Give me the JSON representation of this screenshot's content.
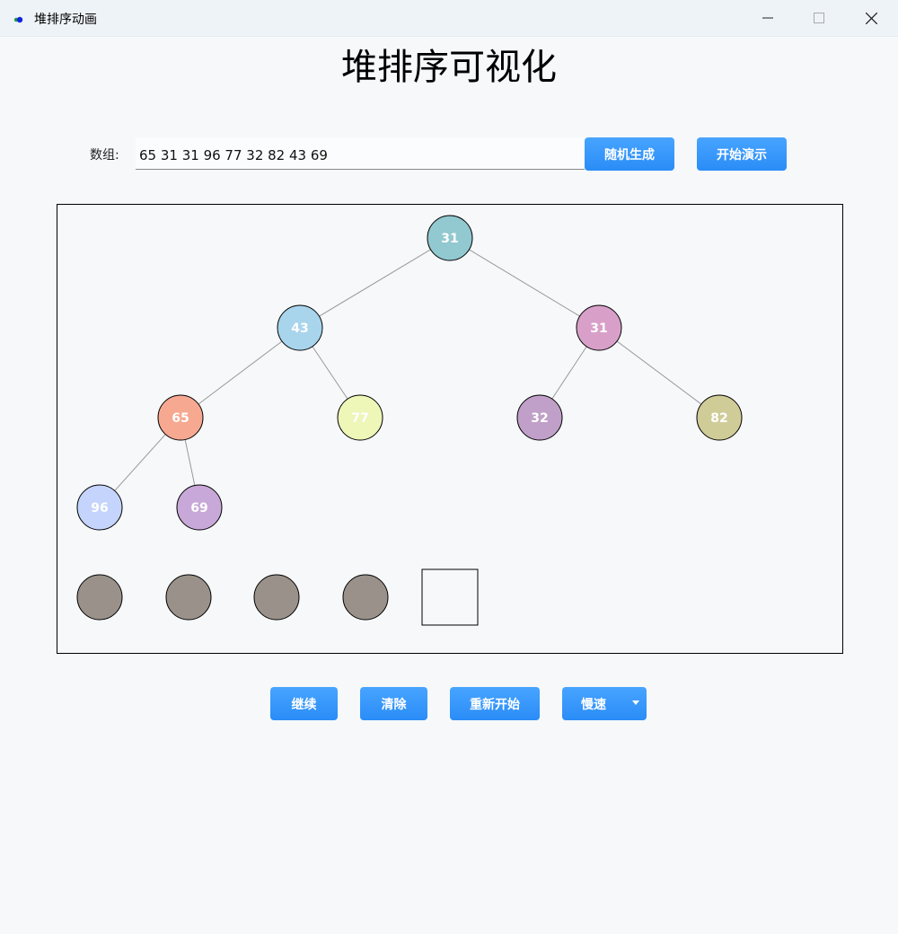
{
  "window": {
    "title": "堆排序动画"
  },
  "page": {
    "title": "堆排序可视化"
  },
  "input": {
    "label": "数组:",
    "value": "65 31 31 96 77 32 82 43 69"
  },
  "buttons": {
    "random": "随机生成",
    "start": "开始演示",
    "continue": "继续",
    "clear": "清除",
    "restart": "重新开始",
    "speed": "慢速"
  },
  "tree": {
    "nodes": [
      {
        "value": "31",
        "color": "#92c8d0"
      },
      {
        "value": "43",
        "color": "#a8d4ec"
      },
      {
        "value": "31",
        "color": "#d8a0c8"
      },
      {
        "value": "65",
        "color": "#f6a890"
      },
      {
        "value": "77",
        "color": "#eef6b8"
      },
      {
        "value": "32",
        "color": "#c0a0c8"
      },
      {
        "value": "82",
        "color": "#d0cc98"
      },
      {
        "value": "96",
        "color": "#c4d4fc"
      },
      {
        "value": "69",
        "color": "#c8a8d8"
      }
    ],
    "sorted_slots": [
      {
        "color": "#9a928a"
      },
      {
        "color": "#9a928a"
      },
      {
        "color": "#9a928a"
      },
      {
        "color": "#9a928a"
      }
    ],
    "edge_color": "#999999"
  },
  "colors": {
    "accent": "#2a8cf7",
    "background": "#f6f8fa"
  }
}
